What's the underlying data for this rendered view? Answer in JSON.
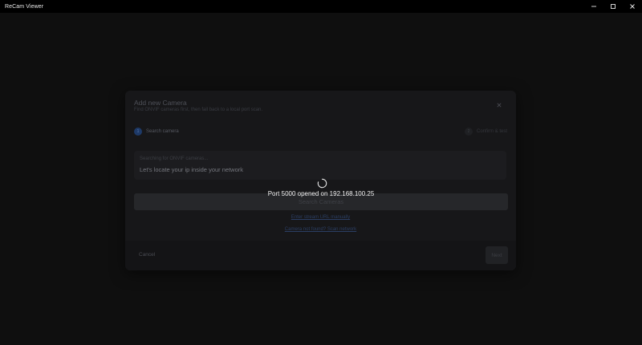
{
  "window": {
    "title": "ReCam Viewer",
    "controls": [
      "minimize-icon",
      "maximize-icon",
      "close-icon"
    ]
  },
  "dialog": {
    "title": "Add new Camera",
    "subtitle": "Find ONVIF cameras first, then fall back to a local port scan.",
    "steps": [
      {
        "number": "1",
        "label": "Search camera",
        "active": true
      },
      {
        "number": "2",
        "label": "Confirm & test",
        "active": false
      }
    ],
    "search": {
      "status": "Searching for ONVIF cameras...",
      "message": "Let's locate your ip inside your network"
    },
    "search_button": "Search Cameras",
    "manual_link": "Enter stream URL manually",
    "scan_link": "Camera not found? Scan network",
    "cancel_label": "Cancel",
    "next_label": "Next"
  },
  "overlay": {
    "progress_text": "Port 5000 opened on 192.168.100.25"
  },
  "colors": {
    "titlebar": "#000000",
    "background": "#0f0f0f",
    "dialog": "#171719",
    "accent": "#1e3a68"
  }
}
